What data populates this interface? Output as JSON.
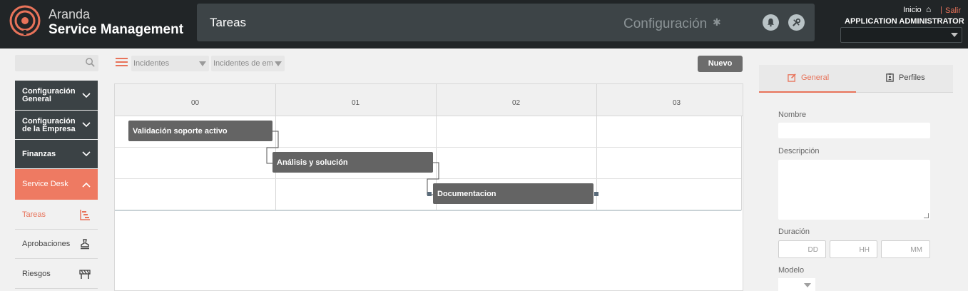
{
  "app": {
    "brand_line1": "Aranda",
    "brand_line2": "Service Management",
    "accent_color": "#e8735a",
    "logo_icon": "aranda-logo-icon"
  },
  "header": {
    "page_title": "Tareas",
    "config_label": "Configuración",
    "config_icon": "gear-icon",
    "notification_icon": "bell-icon",
    "tools_icon": "tools-icon",
    "home_label": "Inicio",
    "home_icon": "home-icon",
    "separator": "|",
    "logout_label": "Salir",
    "user_name": "APPLICATION ADMINISTRATOR",
    "user_select_value": ""
  },
  "sidebar": {
    "search_placeholder": "",
    "groups": [
      {
        "label_line1": "Configuración",
        "label_line2": "General",
        "expanded": false
      },
      {
        "label_line1": "Configuración",
        "label_line2": "de la Empresa",
        "expanded": false
      },
      {
        "label_line1": "Finanzas",
        "label_line2": "",
        "expanded": false
      },
      {
        "label_line1": "Service Desk",
        "label_line2": "",
        "expanded": true
      }
    ],
    "sub_items": [
      {
        "label": "Tareas",
        "icon": "gantt-chart-icon",
        "current": true
      },
      {
        "label": "Aprobaciones",
        "icon": "stamp-icon",
        "current": false
      },
      {
        "label": "Riesgos",
        "icon": "barrier-icon",
        "current": false
      }
    ]
  },
  "toolbar": {
    "menu_icon": "hamburger-menu-icon",
    "filter1_value": "Incidentes",
    "filter2_value": "Incidentes de em",
    "new_button_label": "Nuevo"
  },
  "gantt": {
    "columns": [
      "00",
      "01",
      "02",
      "03"
    ],
    "tasks": [
      {
        "label": "Validación soporte activo",
        "start": 0.0,
        "duration": 0.9
      },
      {
        "label": "Análisis y solución",
        "start": 0.98,
        "duration": 1.0
      },
      {
        "label": "Documentacion",
        "start": 1.98,
        "duration": 1.0
      }
    ],
    "dependencies": [
      [
        0,
        1
      ],
      [
        1,
        2
      ]
    ]
  },
  "panel": {
    "tab_general": "General",
    "tab_general_icon": "edit-icon",
    "tab_profiles": "Perfiles",
    "tab_profiles_icon": "clipboard-user-icon",
    "name_label": "Nombre",
    "name_value": "",
    "description_label": "Descripción",
    "description_value": "",
    "duration_label": "Duración",
    "duration_days_placeholder": "DD",
    "duration_hours_placeholder": "HH",
    "duration_minutes_placeholder": "MM",
    "model_label": "Modelo",
    "model_value": ""
  }
}
